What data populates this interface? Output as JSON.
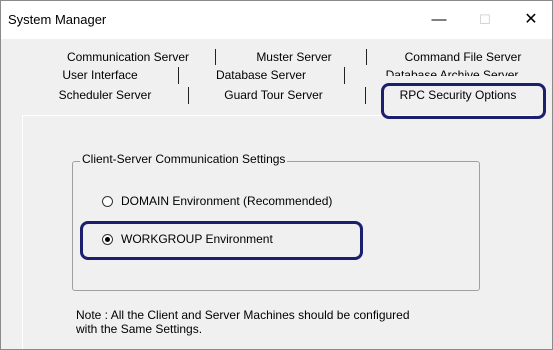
{
  "window": {
    "title": "System Manager",
    "controls": {
      "minimize": "—",
      "maximize": "☐",
      "close": "✕"
    }
  },
  "tabs": {
    "row1": [
      "Communication Server",
      "Muster Server",
      "Command File Server"
    ],
    "row2": [
      "User Interface",
      "Database Server",
      "Database Archive Server"
    ],
    "row3": [
      "Scheduler Server",
      "Guard Tour Server",
      "RPC Security Options"
    ]
  },
  "group": {
    "title": "Client-Server Communication Settings",
    "options": [
      {
        "label": "DOMAIN Environment (Recommended)",
        "selected": false
      },
      {
        "label": "WORKGROUP Environment",
        "selected": true
      }
    ]
  },
  "note": {
    "line1": "Note : All the Client and Server Machines should be configured",
    "line2": "with the Same Settings."
  },
  "colors": {
    "highlight": "#1c1e6e",
    "panel_bg": "#f0f0f0"
  }
}
